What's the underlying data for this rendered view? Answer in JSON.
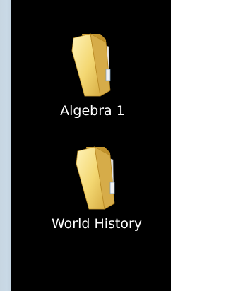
{
  "desktop": {
    "items": [
      {
        "label": "Algebra 1",
        "icon": "folder-icon"
      },
      {
        "label": "World History",
        "icon": "folder-icon"
      }
    ],
    "colors": {
      "background": "#000000",
      "left_border": "#c9d9e6",
      "label_text": "#ffffff",
      "folder_light": "#f8e79a",
      "folder_dark": "#d8b049"
    }
  }
}
